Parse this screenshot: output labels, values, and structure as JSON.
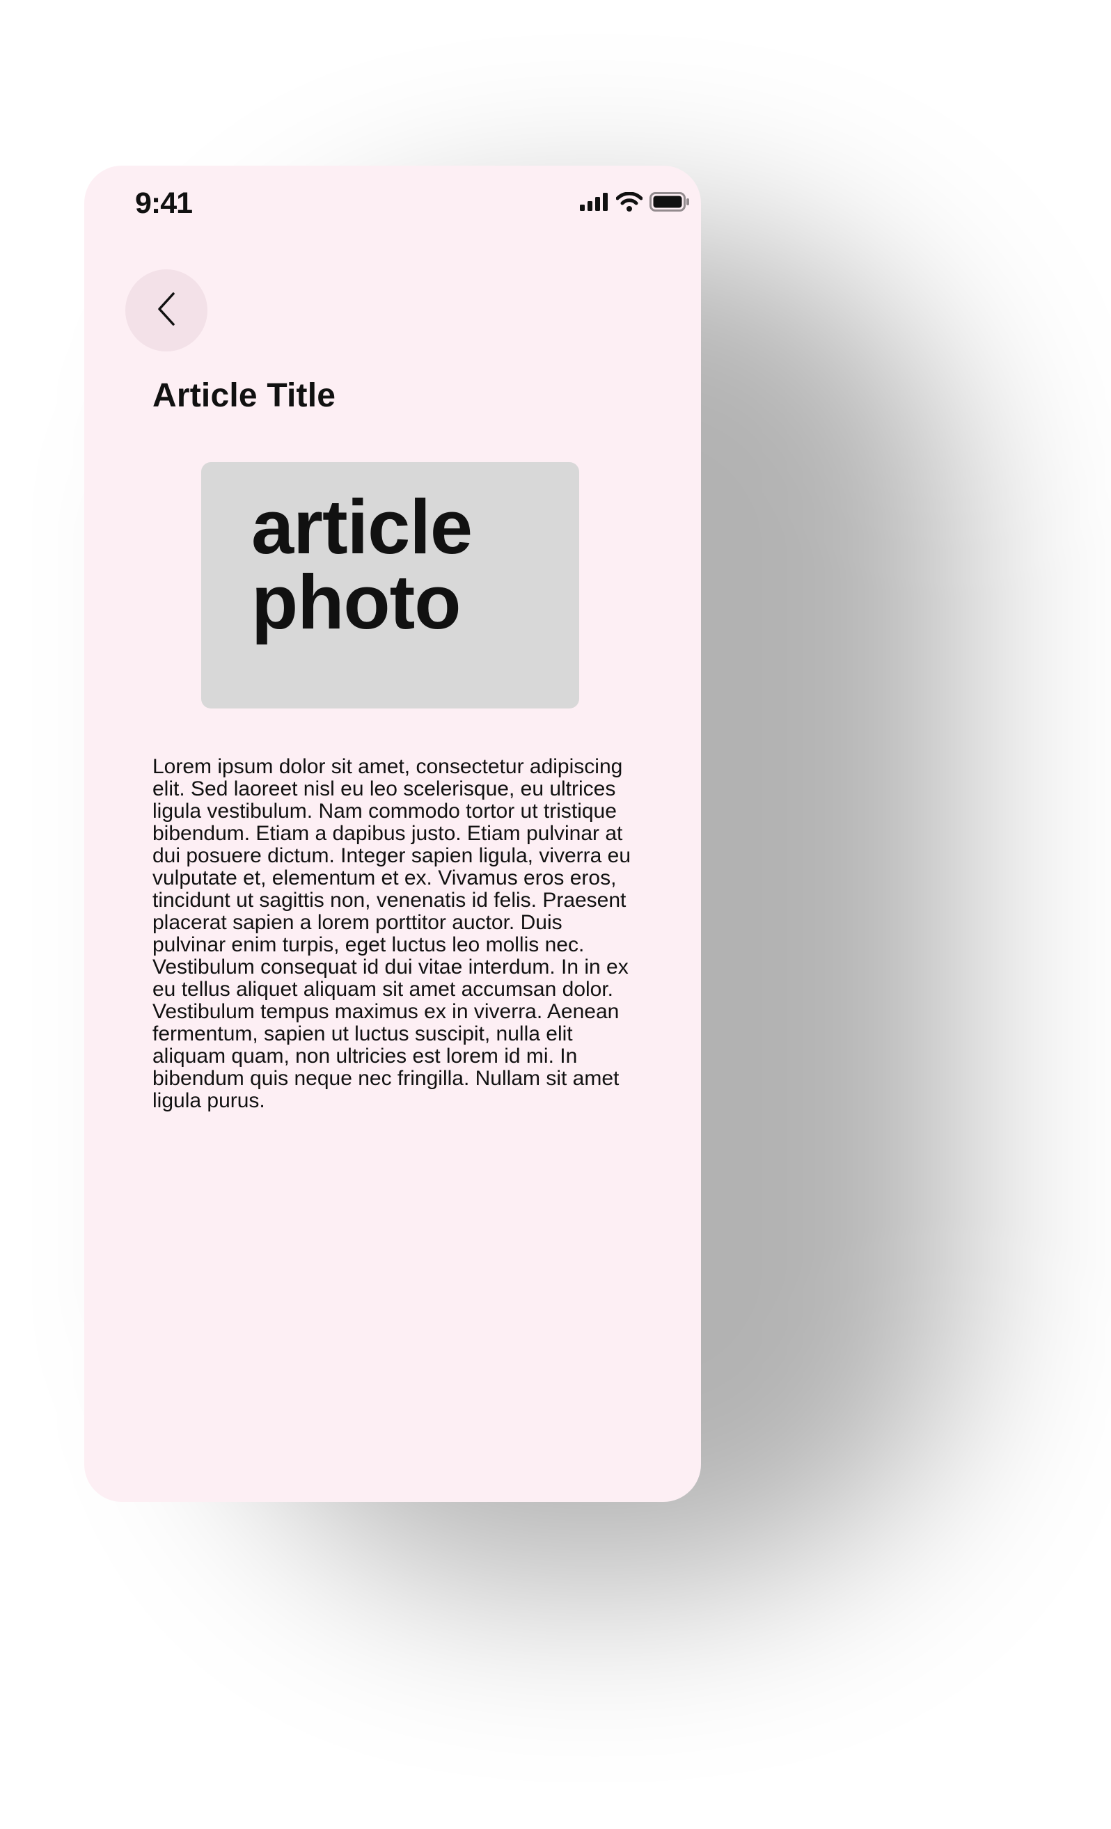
{
  "status_bar": {
    "time": "9:41",
    "icons": [
      "cellular-signal-icon",
      "wifi-icon",
      "battery-icon"
    ]
  },
  "header": {
    "back_icon": "chevron-left-icon"
  },
  "article": {
    "title": "Article Title",
    "photo_placeholder": "article\nphoto",
    "body": "Lorem ipsum dolor sit amet, consectetur adipiscing elit. Sed laoreet nisl eu leo scelerisque, eu ultrices ligula vestibulum. Nam commodo tortor ut tristique bibendum. Etiam a dapibus justo. Etiam pulvinar at dui posuere dictum. Integer sapien ligula, viverra eu vulputate et, elementum et ex. Vivamus eros eros, tincidunt ut sagittis non, venenatis id felis. Praesent placerat sapien a lorem porttitor auctor. Duis pulvinar enim turpis, eget luctus leo mollis nec. Vestibulum consequat id dui vitae interdum. In in ex eu tellus aliquet aliquam sit amet accumsan dolor. Vestibulum tempus maximus ex in viverra. Aenean fermentum, sapien ut luctus suscipit, nulla elit aliquam quam, non ultricies est lorem id mi. In bibendum quis neque nec fringilla. Nullam sit amet ligula purus."
  },
  "colors": {
    "screen_background": "#fdeff4",
    "back_button_background": "#f3e1e8",
    "photo_placeholder_background": "#d8d8d8",
    "text": "#111111"
  }
}
